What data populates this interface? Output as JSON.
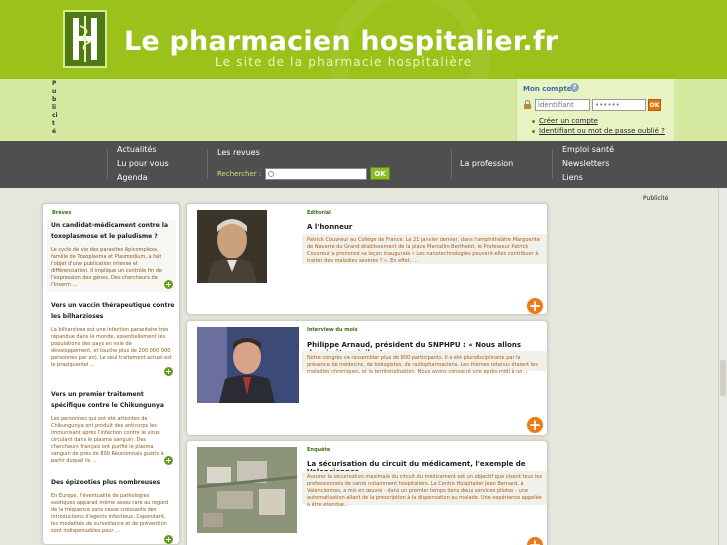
{
  "header": {
    "title": "Le pharmacien hospitalier.fr",
    "subtitle": "Le site de la pharmacie hospitalière"
  },
  "pub_vertical": "Publicité",
  "account": {
    "title": "Mon compte",
    "login_placeholder": "identifiant",
    "password_value": "••••••",
    "ok_label": "OK",
    "links": [
      "Créer un compte",
      "Identifiant ou mot de passe oublié ?"
    ]
  },
  "nav": {
    "col1": [
      "Actualités",
      "Lu pour vous",
      "Agenda"
    ],
    "col2": [
      "Les revues"
    ],
    "search_label": "Rechercher :",
    "search_ok": "OK",
    "col3": [
      "La profession"
    ],
    "col4": [
      "Emploi santé",
      "Newsletters",
      "Liens"
    ]
  },
  "pub_right": "Publicité",
  "briefs": {
    "section": "Brèves",
    "items": [
      {
        "title": "Un candidat-médicament contre la toxoplasmose et le paludisme ?",
        "desc": "Le cycle de vie des parasites Apicomplexa, famille de Toxoplasma et Plasmodium, a fait l'objet d'une publication intense et différenciation. Il implique un contrôle fin de l'expression des gènes. Des chercheurs de l'Inserm ..."
      },
      {
        "title": "Vers un vaccin thérapeutique contre les bilharzioses",
        "desc": "La bilharziose est une infection parasitaire très répandue dans le monde, essentiellement les populations des pays en voie de développement, et touche plus de 200 000 000 personnes par an). Le seul traitement actuel est le praziquantel ..."
      },
      {
        "title": "Vers un premier traitement spécifique contre le Chikungunya",
        "desc": "Les personnes qui ont été atteintes de Chikungunya ont produit des anticorps les immunisant après l'infection contre le virus circulant dans le plasma sanguin. Des chercheurs français ont purifié le plasma sanguin de près de 800 Réunionnais guéris à partir duquel ils ..."
      },
      {
        "title": "Des épizooties plus nombreuses",
        "desc": "En Europe, l'éventualité de pathologies exotiques apparait même assez rare au regard de la fréquence sans cesse croissante des introductions d'agents infectieux. Cependant, les modalités de surveillance et de prévention sont indispensables pour ..."
      }
    ]
  },
  "articles": [
    {
      "category": "Editorial",
      "headline": "A l'honneur",
      "summary": "Patrick Couvreur au Collège de France. Le 21 janvier dernier, dans l'amphithéâtre Marguerite de Navarre du Grand établissement de la place Marcellin-Berthelot, le Professeur Patrick Couvreur a prononcé sa leçon inaugurale « Les nanotechnologies peuvent-elles contribuer à traiter des maladies sévères ? ». En effet, ..."
    },
    {
      "category": "Interview du mois",
      "headline": "Philippe Arnaud, président du SNPHPU : « Nous allons devoir être vigilants »",
      "summary": "Notre congrès va rassembler plus de 800 participants. Il a été pluridisciplinaire par la présence de médecins, de biologistes, de radiopharmaciens. Les thèmes retenus étaient les maladies chroniques, et la territorialisation. Nous avons consacré une après-midi à un ..."
    },
    {
      "category": "Enquête",
      "headline": "La sécurisation du circuit du médicament, l'exemple de Valenciennes",
      "summary": "Assurer la sécurisation maximale du circuit du médicament est un objectif que visent tous les professionnels de santé notamment hospitaliers. Le Centre Hospitalier Jean Bernard, à Valenciennes, a mis en œuvre - dans un premier temps dans deux services pilotes - une automatisation allant de la prescription à la dispensation au malade. Une expérience appelée à être étendue..."
    }
  ],
  "colors": {
    "header_green": "#9ac21a",
    "nav_gray": "#4f4f4f",
    "accent_orange": "#ee7b15",
    "section_green": "#3c6b12"
  }
}
